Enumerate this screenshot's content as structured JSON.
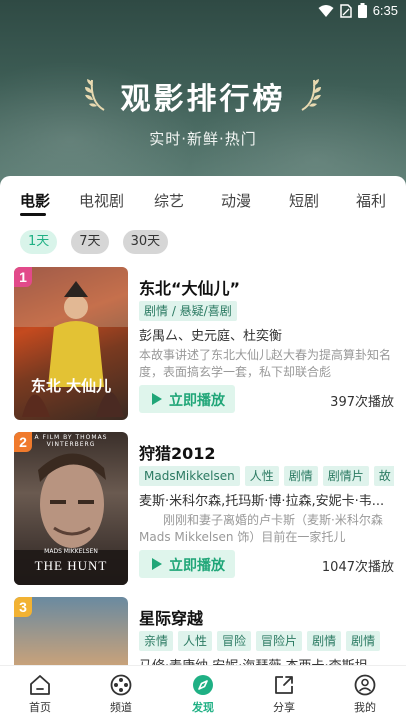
{
  "status": {
    "time": "6:35"
  },
  "hero": {
    "title": "观影排行榜",
    "subtitle": "实时·新鲜·热门"
  },
  "tabs": [
    "电影",
    "电视剧",
    "综艺",
    "动漫",
    "短剧",
    "福利"
  ],
  "active_tab": "电影",
  "ranges": [
    "1天",
    "7天",
    "30天"
  ],
  "active_range": "1天",
  "play_label": "立即播放",
  "movies": [
    {
      "rank": "1",
      "title": "东北“大仙儿”",
      "poster_text": "东北 大仙儿",
      "tags": [
        "剧情 / 悬疑/喜剧"
      ],
      "cast": "彭禺厶、史元庭、杜奕衡",
      "desc": "本故事讲述了东北大仙儿赵大春为提高算卦知名度，表面搞玄学一套，私下却联合彪",
      "plays": "397次播放"
    },
    {
      "rank": "2",
      "title": "狩猎2012",
      "poster_top": "A FILM BY THOMAS VINTERBERG",
      "poster_actor": "MADS MIKKELSEN",
      "poster_text": "THE HUNT",
      "tags": [
        "MadsMikkelsen",
        "人性",
        "剧情",
        "剧情片",
        "故"
      ],
      "cast": "麦斯·米科尔森,托玛斯·博·拉森,安妮卡·韦...",
      "desc": "　　刚刚和妻子离婚的卢卡斯（麦斯·米科尔森 Mads Mikkelsen 饰）目前在一家托儿",
      "plays": "1047次播放"
    },
    {
      "rank": "3",
      "title": "星际穿越",
      "tags": [
        "亲情",
        "人性",
        "冒险",
        "冒险片",
        "剧情",
        "剧情"
      ],
      "cast": "马修·麦康纳,安妮·海瑟薇,杰西卡·查斯坦"
    }
  ],
  "nav": [
    {
      "label": "首页",
      "icon": "home-icon"
    },
    {
      "label": "频道",
      "icon": "film-reel-icon"
    },
    {
      "label": "发现",
      "icon": "compass-icon"
    },
    {
      "label": "分享",
      "icon": "share-icon"
    },
    {
      "label": "我的",
      "icon": "user-icon"
    }
  ],
  "active_nav": "发现",
  "colors": {
    "accent": "#1fb084",
    "hero": "#3e5e56",
    "rank1": "#e24a8a",
    "rank2": "#f07a2c",
    "rank3": "#f2b233"
  }
}
